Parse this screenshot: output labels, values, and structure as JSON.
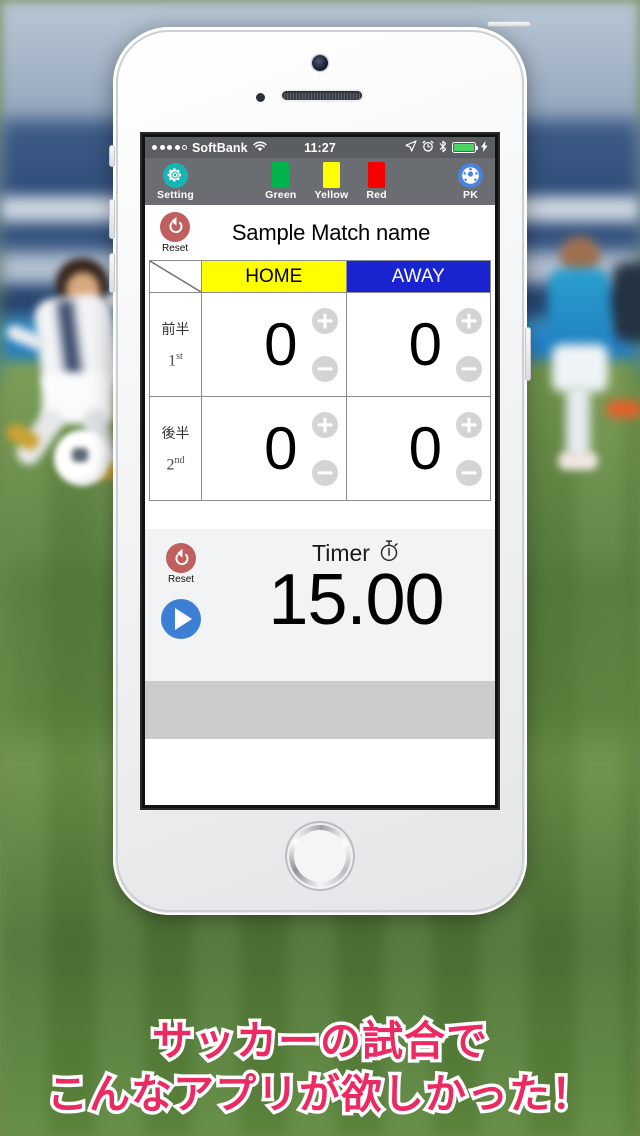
{
  "background": {
    "description": "blurred soccer field photo with young players"
  },
  "device": {
    "model_color": "white",
    "icons": {
      "camera": "camera-icon",
      "speaker": "speaker-grille-icon",
      "sensor": "proximity-sensor-icon",
      "home": "home-button-icon"
    }
  },
  "status_bar": {
    "signal_dots_filled": 4,
    "signal_dots_total": 5,
    "carrier": "SoftBank",
    "wifi_icon": "wifi-icon",
    "time": "11:27",
    "location_icon": "location-arrow-icon",
    "alarm_icon": "alarm-clock-icon",
    "bluetooth_icon": "bluetooth-icon",
    "battery_icon": "battery-icon",
    "charging_icon": "charging-bolt-icon",
    "battery_color": "#4cd464",
    "background_color": "#5a5d62"
  },
  "toolbar": {
    "background_color": "#6a6d71",
    "setting": {
      "label": "Setting",
      "icon": "gear-icon",
      "color": "#17b6b6"
    },
    "cards": [
      {
        "label": "Green",
        "color": "#00b34a"
      },
      {
        "label": "Yellow",
        "color": "#ffff00"
      },
      {
        "label": "Red",
        "color": "#f50000"
      }
    ],
    "pk": {
      "label": "PK",
      "icon": "soccer-ball-icon",
      "color": "#4b83de"
    }
  },
  "match": {
    "reset_label": "Reset",
    "reset_icon": "refresh-icon",
    "reset_color": "#c0605e",
    "name": "Sample Match name"
  },
  "scoreboard": {
    "corner_icon": "diagonal-divider-icon",
    "teams": [
      {
        "name": "HOME",
        "bg": "#ffff00",
        "fg": "#000000"
      },
      {
        "name": "AWAY",
        "bg": "#1a23d0",
        "fg": "#ffffff"
      }
    ],
    "rows": [
      {
        "half_jp": "前半",
        "half_en_num": "1",
        "half_en_suffix": "st",
        "scores": [
          "0",
          "0"
        ]
      },
      {
        "half_jp": "後半",
        "half_en_num": "2",
        "half_en_suffix": "nd",
        "scores": [
          "0",
          "0"
        ]
      }
    ],
    "increment_icon": "plus-circle-icon",
    "decrement_icon": "minus-circle-icon"
  },
  "timer": {
    "reset_label": "Reset",
    "reset_icon": "refresh-icon",
    "play_icon": "play-icon",
    "play_color": "#3d7fd4",
    "title": "Timer",
    "stopwatch_icon": "stopwatch-icon",
    "value": "15.00",
    "background_color": "#f2f3f4"
  },
  "bottom_bar": {
    "color": "#cbcbcb"
  },
  "caption": {
    "line1": "サッカーの試合で",
    "line2": "こんなアプリが欲しかった！",
    "color": "#ec2a62",
    "outline_color": "#ffffff"
  }
}
